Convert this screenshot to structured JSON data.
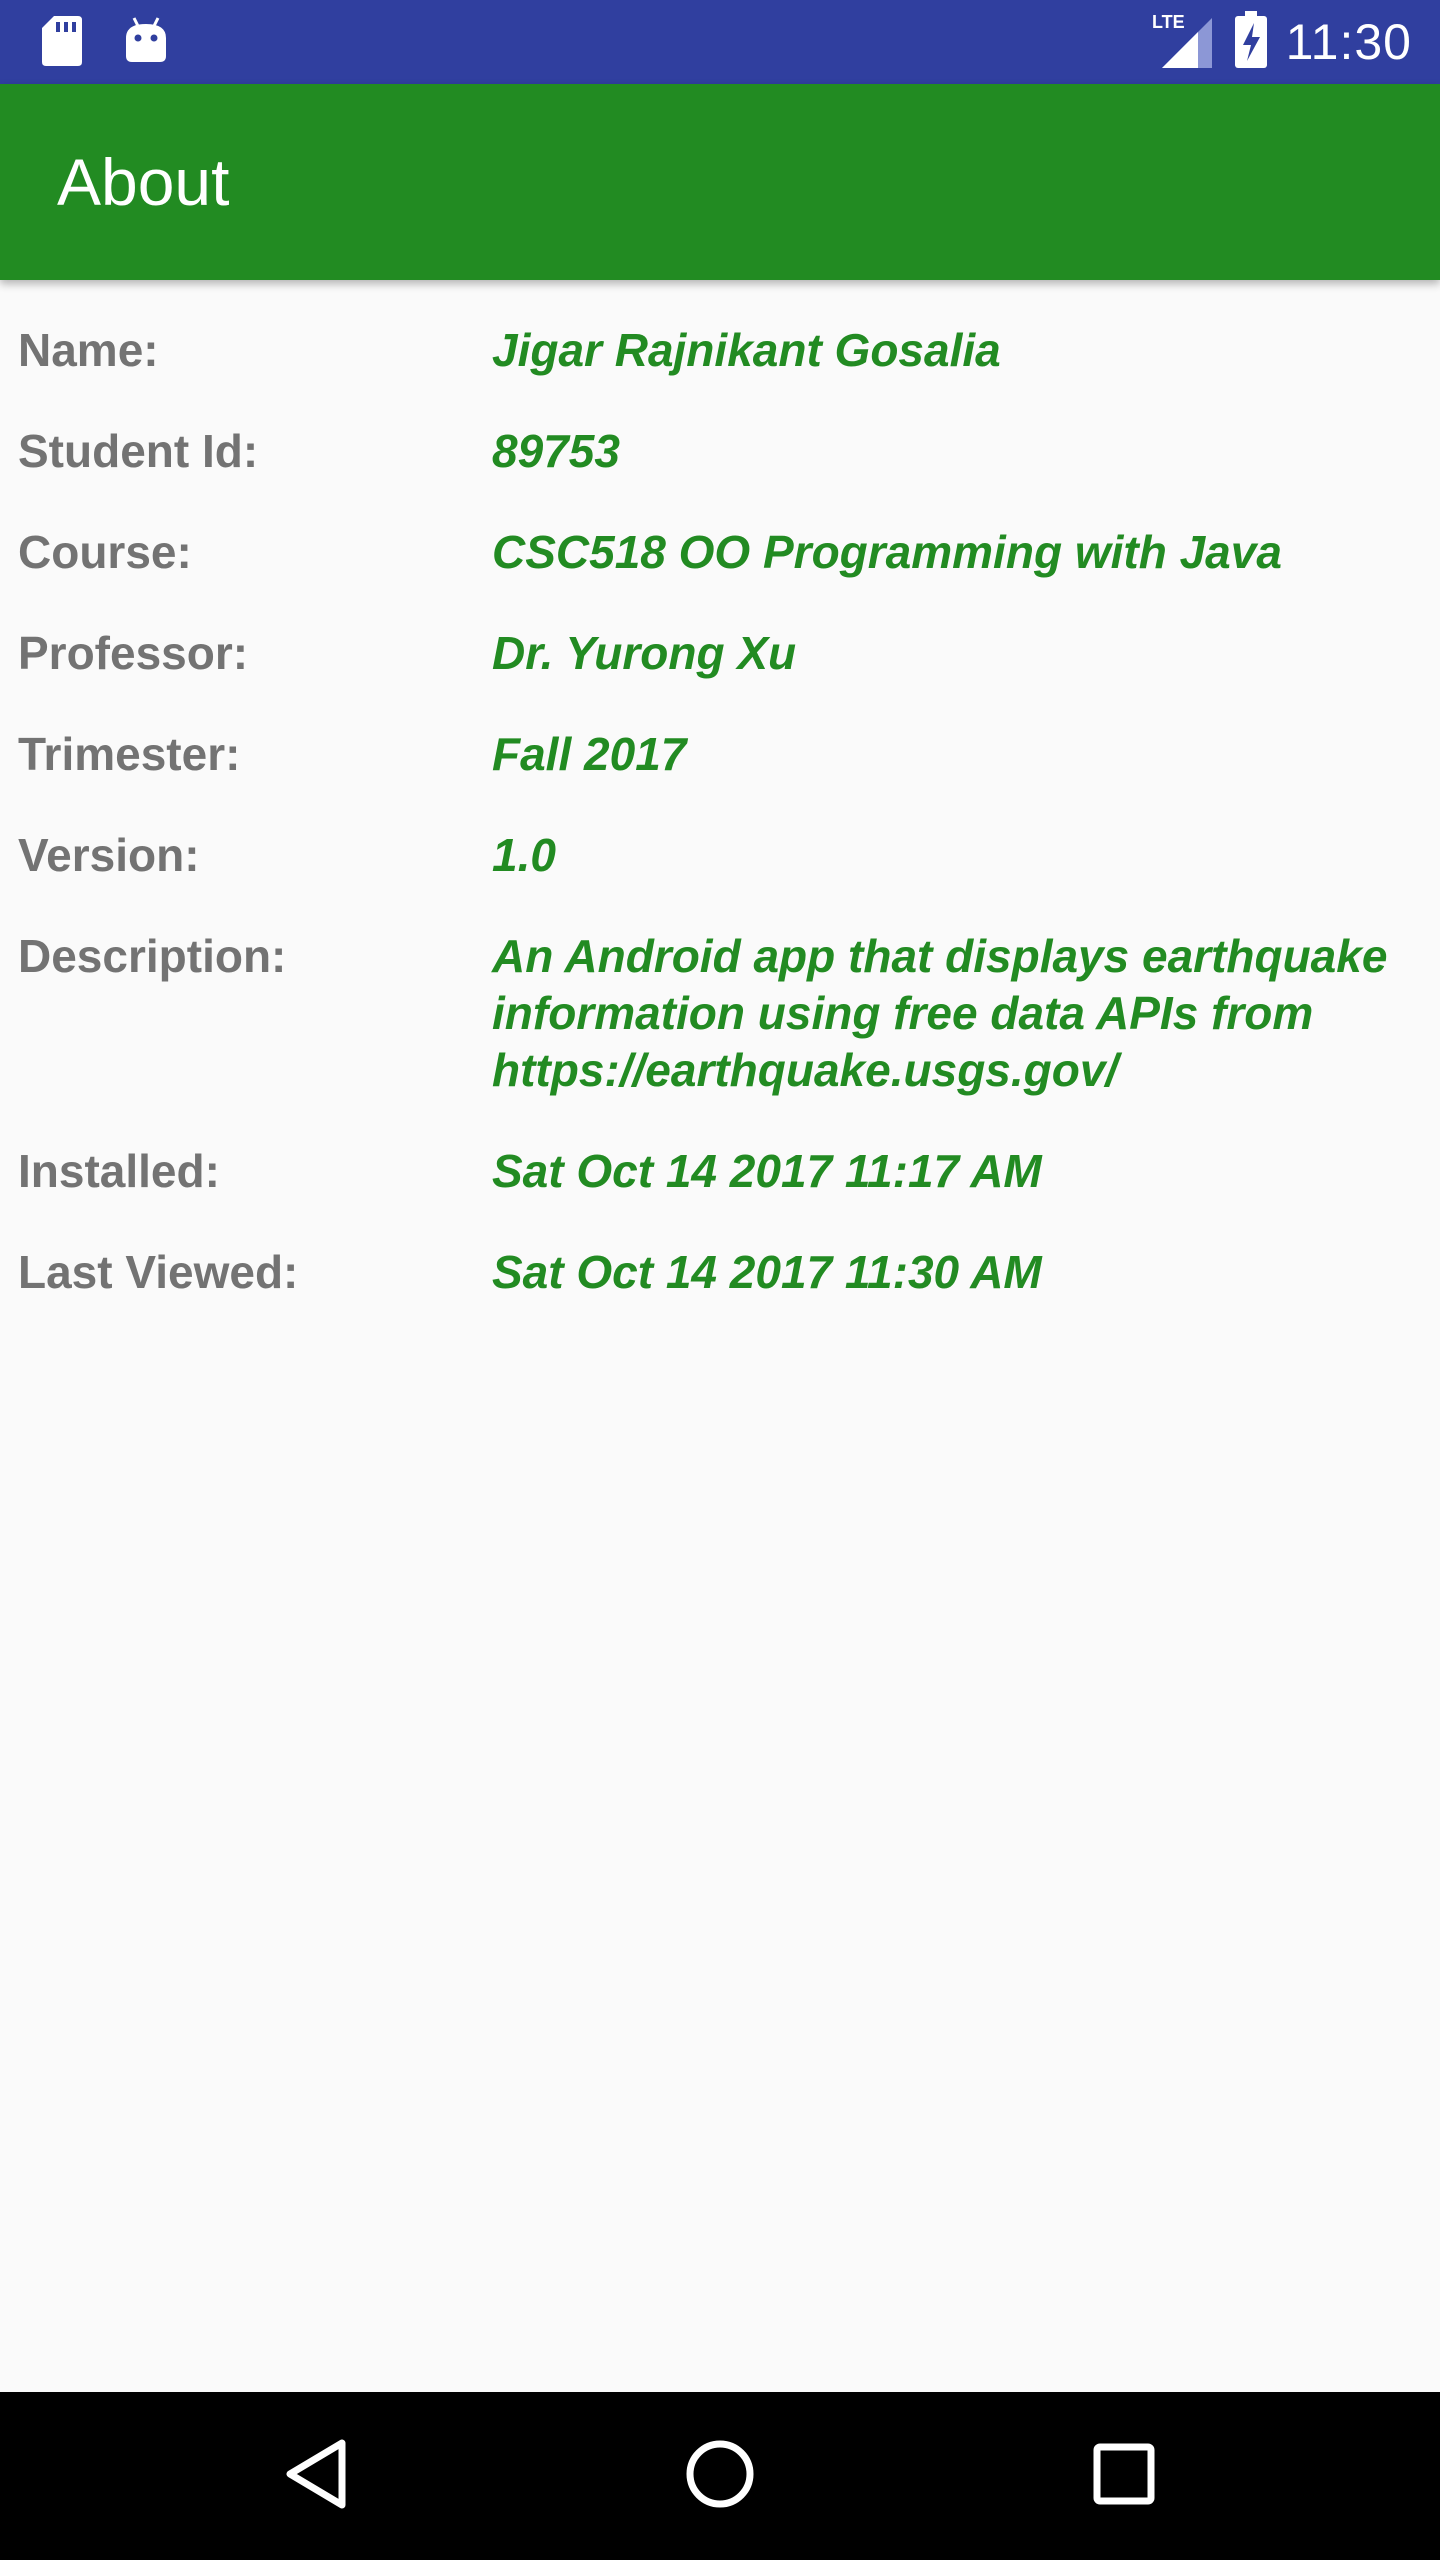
{
  "status_bar": {
    "time": "11:30",
    "network_label": "LTE",
    "icons": [
      "sd-card-icon",
      "android-icon",
      "lte-signal-icon",
      "battery-charging-icon"
    ]
  },
  "app_bar": {
    "title": "About"
  },
  "info": [
    {
      "label": "Name:",
      "value": "Jigar Rajnikant Gosalia"
    },
    {
      "label": "Student Id:",
      "value": "89753"
    },
    {
      "label": "Course:",
      "value": "CSC518 OO Programming with Java"
    },
    {
      "label": "Professor:",
      "value": "Dr. Yurong Xu"
    },
    {
      "label": "Trimester:",
      "value": "Fall 2017"
    },
    {
      "label": "Version:",
      "value": "1.0"
    },
    {
      "label": "Description:",
      "value": "An Android app that displays earthquake information using free data APIs from https://earthquake.usgs.gov/"
    },
    {
      "label": "Installed:",
      "value": "Sat Oct 14 2017 11:17 AM"
    },
    {
      "label": "Last Viewed:",
      "value": "Sat Oct 14 2017 11:30 AM"
    }
  ],
  "nav_bar": {
    "icons": [
      "back-icon",
      "home-icon",
      "recents-icon"
    ]
  },
  "colors": {
    "status_bar": "#303f9f",
    "app_bar": "#228b22",
    "label_text": "#737373",
    "value_text": "#228b22",
    "background": "#fafafa"
  }
}
